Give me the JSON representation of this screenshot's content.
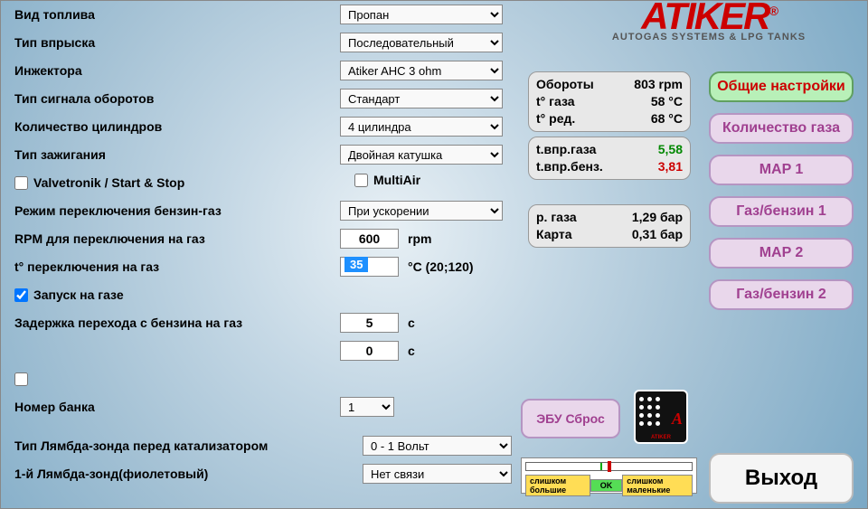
{
  "brand": {
    "name": "ATIKER",
    "reg": "®",
    "tagline": "AUTOGAS SYSTEMS & LPG TANKS"
  },
  "labels": {
    "fuel_type": "Вид топлива",
    "inj_type": "Тип впрыска",
    "injectors": "Инжектора",
    "rpm_signal": "Тип сигнала оборотов",
    "cyl_count": "Количество цилиндров",
    "ign_type": "Тип зажигания",
    "valvetronik": "Valvetronik / Start & Stop",
    "multiair": "MultiAir",
    "switch_mode": "Режим переключения бензин-газ",
    "rpm_switch": "RPM для переключения на газ",
    "t_switch": "t° переключения на газ",
    "start_on_gas": "Запуск на газе",
    "delay_pg": "Задержка перехода с бензина на газ",
    "bank_no": "Номер банка",
    "lambda_type": "Тип Лямбда-зонда перед катализатором",
    "lambda1": "1-й Лямбда-зонд(фиолетовый)"
  },
  "values": {
    "fuel_type": "Пропан",
    "inj_type": "Последовательный",
    "injectors": "Atiker AHC 3 ohm",
    "rpm_signal": "Стандарт",
    "cyl_count": "4 цилиндра",
    "ign_type": "Двойная катушка",
    "switch_mode": "При ускорении",
    "rpm_switch": "600",
    "t_switch": "35",
    "delay1": "5",
    "delay2": "0",
    "bank_no": "1",
    "lambda_type": "0 - 1 Вольт",
    "lambda1": "Нет связи",
    "start_on_gas_checked": true
  },
  "units": {
    "rpm": "rpm",
    "t_range": "°C  (20;120)",
    "sec": "с"
  },
  "readouts": {
    "r1": [
      {
        "k": "Обороты",
        "v": "803 rpm"
      },
      {
        "k": "t° газа",
        "v": "58 °C"
      },
      {
        "k": "t° ред.",
        "v": "68 °C"
      }
    ],
    "r2": [
      {
        "k": "t.впр.газа",
        "v": "5,58",
        "cls": "green"
      },
      {
        "k": "t.впр.бенз.",
        "v": "3,81",
        "cls": "red"
      }
    ],
    "r3": [
      {
        "k": "р. газа",
        "v": "1,29 бар"
      },
      {
        "k": "Карта",
        "v": "0,31 бар"
      }
    ]
  },
  "nav": {
    "general": "Общие настройки",
    "gas_qty": "Количество газа",
    "map1": "MAP 1",
    "gb1": "Газ/бензин 1",
    "map2": "MAP 2",
    "gb2": "Газ/бензин 2"
  },
  "ecu_reset": "ЭБУ Сброс",
  "exit": "Выход",
  "gauge": {
    "too_big": "слишком большие",
    "ok": "OK",
    "too_small": "слишком маленькие"
  }
}
